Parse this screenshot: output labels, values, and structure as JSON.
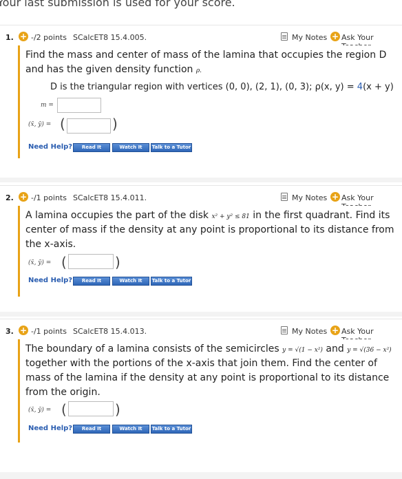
{
  "top_note": "Your last submission is used for your score.",
  "help": {
    "need_help": "Need Help?",
    "read_it": "Read It",
    "watch_it": "Watch It",
    "talk_to_tutor": "Talk to a Tutor"
  },
  "header_links": {
    "my_notes": "My Notes",
    "ask_teacher": "Ask Your Teacher"
  },
  "questions": [
    {
      "number": "1.",
      "points": "-/2 points",
      "code": "SCalcET8 15.4.005.",
      "line1": "Find the mass and center of mass of the lamina that occupies the region D",
      "line2a": "and has the given density function ",
      "line2b": "ρ.",
      "line3a": "D is the triangular region with vertices (0, 0), (2, 1), (0, 3); ρ(x, y) = ",
      "line3b": "4",
      "line3c": "(x + y)",
      "m_label": "m =",
      "xy_label": "(x̄, ȳ) ="
    },
    {
      "number": "2.",
      "points": "-/1 points",
      "code": "SCalcET8 15.4.011.",
      "line1a": "A lamina occupies the part of the disk ",
      "ineq": "x² + y² ≤ 81",
      "line1b": " in the first quadrant. Find its",
      "line2": "center of mass if the density at any point is proportional to its distance from",
      "line3": "the x-axis.",
      "xy_label": "(x̄, ȳ) ="
    },
    {
      "number": "3.",
      "points": "-/1 points",
      "code": "SCalcET8 15.4.013.",
      "line1a": "The boundary of a lamina consists of the semicircles ",
      "eq1": "y = √(1 − x²)",
      "line1b": " and ",
      "eq2": "y = √(36 − x²)",
      "line2": "together with the portions of the x-axis that join them. Find the center of",
      "line3": "mass of the lamina if the density at any point is proportional to its distance",
      "line4": "from the origin.",
      "xy_label": "(x̄, ȳ) ="
    }
  ]
}
